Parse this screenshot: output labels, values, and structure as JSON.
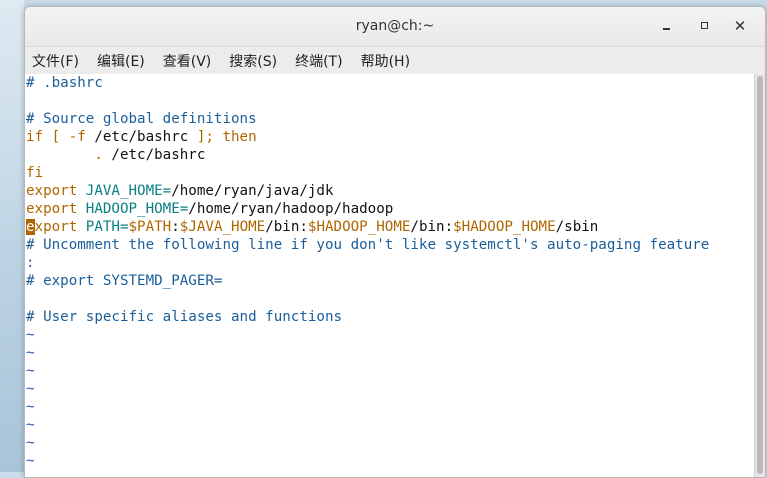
{
  "window": {
    "title": "ryan@ch:~",
    "controls": {
      "minimize": "minimize",
      "maximize": "maximize",
      "close": "✕"
    }
  },
  "menubar": {
    "items": [
      "文件(F)",
      "编辑(E)",
      "查看(V)",
      "搜索(S)",
      "终端(T)",
      "帮助(H)"
    ]
  },
  "editor": {
    "lines": [
      [
        {
          "t": "# .bashrc",
          "c": "comment"
        }
      ],
      [],
      [
        {
          "t": "# Source global definitions",
          "c": "comment"
        }
      ],
      [
        {
          "t": "if [ -f ",
          "c": "keyword"
        },
        {
          "t": "/etc/bashrc",
          "c": "text"
        },
        {
          "t": " ]; then",
          "c": "keyword"
        }
      ],
      [
        {
          "t": "        ",
          "c": "text"
        },
        {
          "t": ".",
          "c": "keyword"
        },
        {
          "t": " /etc/bashrc",
          "c": "text"
        }
      ],
      [
        {
          "t": "fi",
          "c": "keyword"
        }
      ],
      [
        {
          "t": "export ",
          "c": "keyword"
        },
        {
          "t": "JAVA_HOME=",
          "c": "var"
        },
        {
          "t": "/home/ryan/java/jdk",
          "c": "text"
        }
      ],
      [
        {
          "t": "export ",
          "c": "keyword"
        },
        {
          "t": "HADOOP_HOME=",
          "c": "var"
        },
        {
          "t": "/home/ryan/hadoop/hadoop",
          "c": "text"
        }
      ],
      [
        {
          "t": "e",
          "c": "cursor"
        },
        {
          "t": "xport ",
          "c": "keyword"
        },
        {
          "t": "PATH=",
          "c": "var"
        },
        {
          "t": "$PATH",
          "c": "keyword"
        },
        {
          "t": ":",
          "c": "text"
        },
        {
          "t": "$JAVA_HOME",
          "c": "keyword"
        },
        {
          "t": "/bin:",
          "c": "text"
        },
        {
          "t": "$HADOOP_HOME",
          "c": "keyword"
        },
        {
          "t": "/bin:",
          "c": "text"
        },
        {
          "t": "$HADOOP_HOME",
          "c": "keyword"
        },
        {
          "t": "/sbin",
          "c": "text"
        }
      ],
      [
        {
          "t": "# Uncomment the following line if you don't like systemctl's auto-paging feature",
          "c": "comment"
        }
      ],
      [
        {
          "t": ":",
          "c": "comment"
        }
      ],
      [
        {
          "t": "# export SYSTEMD_PAGER=",
          "c": "comment"
        }
      ],
      [],
      [
        {
          "t": "# User specific aliases and functions",
          "c": "comment"
        }
      ],
      [
        {
          "t": "~",
          "c": "tilde"
        }
      ],
      [
        {
          "t": "~",
          "c": "tilde"
        }
      ],
      [
        {
          "t": "~",
          "c": "tilde"
        }
      ],
      [
        {
          "t": "~",
          "c": "tilde"
        }
      ],
      [
        {
          "t": "~",
          "c": "tilde"
        }
      ],
      [
        {
          "t": "~",
          "c": "tilde"
        }
      ],
      [
        {
          "t": "~",
          "c": "tilde"
        }
      ],
      [
        {
          "t": "~",
          "c": "tilde"
        }
      ]
    ]
  },
  "colors": {
    "comment": "#1b5e9a",
    "keyword": "#b06600",
    "variable": "#0a7f83",
    "tilde": "#2a55c0",
    "background": "#ffffff"
  }
}
